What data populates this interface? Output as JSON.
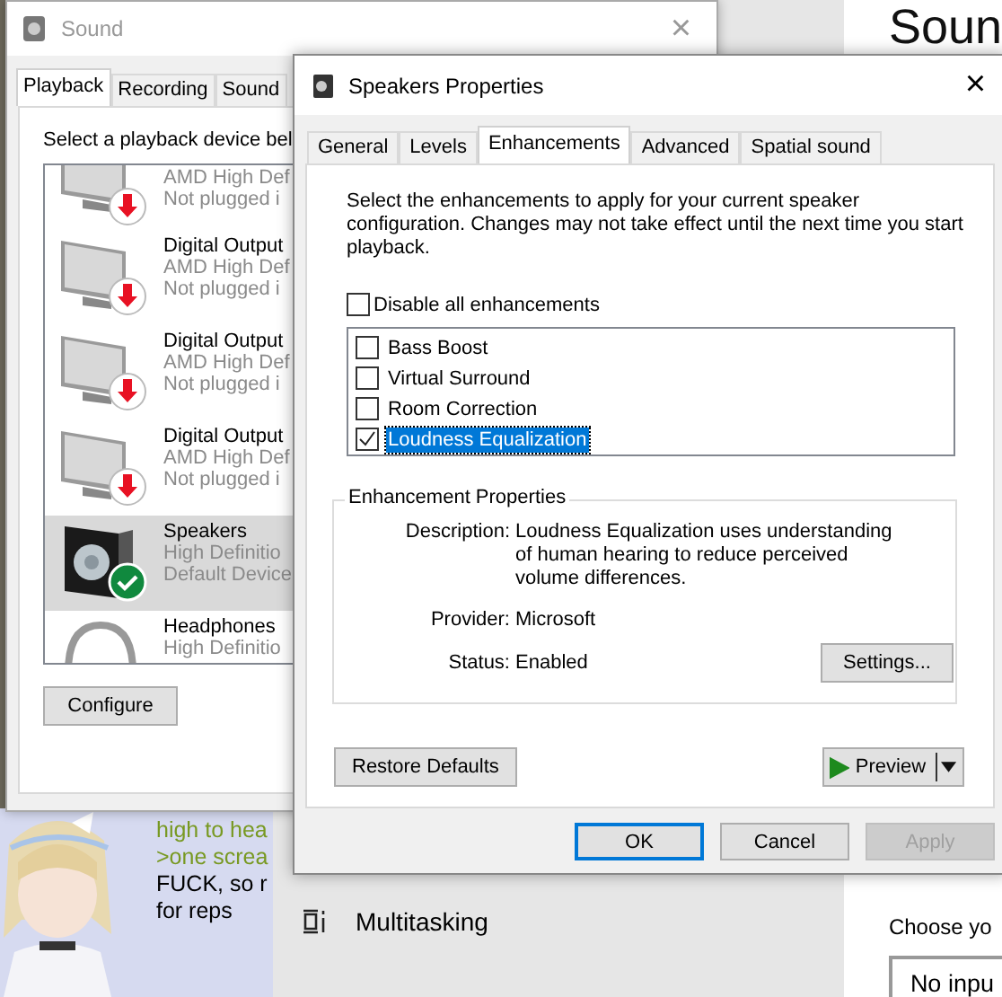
{
  "settings_app": {
    "title": "Soun",
    "sidebar_items": [
      {
        "label": "Multitasking"
      }
    ],
    "prompt": "Choose yo",
    "dropdown": {
      "value": "No inpu"
    }
  },
  "forum_post": {
    "lines": [
      {
        "text": "high to hea",
        "kind": "quote"
      },
      {
        "text": ">one screa",
        "kind": "quote"
      },
      {
        "text": "FUCK, so r",
        "kind": "plain"
      },
      {
        "text": "for reps",
        "kind": "plain"
      }
    ]
  },
  "sound_window": {
    "title": "Sound",
    "close": "×",
    "tabs": [
      {
        "label": "Playback",
        "selected": true
      },
      {
        "label": "Recording",
        "selected": false
      },
      {
        "label": "Sound",
        "selected": false
      }
    ],
    "instruction": "Select a playback device bel",
    "devices": [
      {
        "kind": "monitor",
        "unplugged": true,
        "default": false,
        "selected": false,
        "lines": [
          "AMD High Def",
          "Not plugged i"
        ]
      },
      {
        "kind": "monitor",
        "unplugged": true,
        "default": false,
        "selected": false,
        "name": "Digital Output",
        "lines": [
          "AMD High Def",
          "Not plugged i"
        ]
      },
      {
        "kind": "monitor",
        "unplugged": true,
        "default": false,
        "selected": false,
        "name": "Digital Output",
        "lines": [
          "AMD High Def",
          "Not plugged i"
        ]
      },
      {
        "kind": "monitor",
        "unplugged": true,
        "default": false,
        "selected": false,
        "name": "Digital Output",
        "lines": [
          "AMD High Def",
          "Not plugged i"
        ]
      },
      {
        "kind": "speaker",
        "unplugged": false,
        "default": true,
        "selected": true,
        "name": "Speakers",
        "lines": [
          "High Definitio",
          "Default Device"
        ]
      },
      {
        "kind": "headphones",
        "unplugged": false,
        "default": false,
        "selected": false,
        "name": "Headphones",
        "lines": [
          "High Definitio"
        ]
      }
    ],
    "buttons": [
      "Configure"
    ]
  },
  "properties_dialog": {
    "title": "Speakers Properties",
    "close": "×",
    "tabs": [
      {
        "label": "General",
        "selected": false
      },
      {
        "label": "Levels",
        "selected": false
      },
      {
        "label": "Enhancements",
        "selected": true
      },
      {
        "label": "Advanced",
        "selected": false
      },
      {
        "label": "Spatial sound",
        "selected": false
      }
    ],
    "intro": "Select the enhancements to apply for your current speaker configuration. Changes may not take effect until the next time you start playback.",
    "disable_all": {
      "label": "Disable all enhancements",
      "checked": false
    },
    "enhancements": [
      {
        "label": "Bass Boost",
        "checked": false,
        "selected": false
      },
      {
        "label": "Virtual Surround",
        "checked": false,
        "selected": false
      },
      {
        "label": "Room Correction",
        "checked": false,
        "selected": false
      },
      {
        "label": "Loudness Equalization",
        "checked": true,
        "selected": true
      }
    ],
    "properties": {
      "title": "Enhancement Properties",
      "rows": [
        {
          "label": "Description:",
          "value": "Loudness Equalization uses understanding of human hearing to reduce perceived volume differences."
        },
        {
          "label": "Provider:",
          "value": "Microsoft"
        },
        {
          "label": "Status:",
          "value": "Enabled"
        }
      ],
      "settings_button": "Settings..."
    },
    "restore_button": "Restore Defaults",
    "preview_button": "Preview",
    "buttons": [
      {
        "label": "OK",
        "kind": "default",
        "disabled": false
      },
      {
        "label": "Cancel",
        "kind": "normal",
        "disabled": false
      },
      {
        "label": "Apply",
        "kind": "normal",
        "disabled": true
      }
    ]
  }
}
